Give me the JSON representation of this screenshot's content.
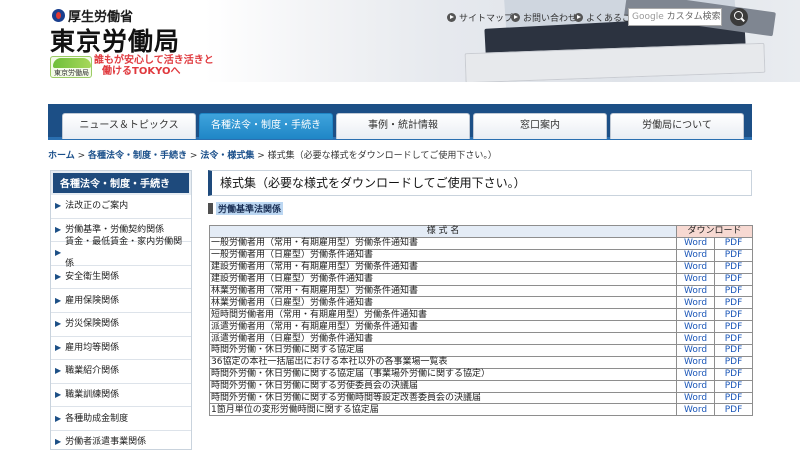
{
  "header": {
    "ministry": "厚生労働省",
    "bureau": "東京労働局",
    "badge_text": "東京労働局",
    "slogan_line1": "誰もが安心して活き活きと",
    "slogan_line2": "働けるTOKYOへ",
    "utility_links": [
      "サイトマップ",
      "お問い合わせ",
      "よくあるご質問"
    ],
    "search_logo": "Google",
    "search_placeholder": "カスタム検索"
  },
  "nav": {
    "tabs": [
      "ニュース＆トピックス",
      "各種法令・制度・手続き",
      "事例・統計情報",
      "窓口案内",
      "労働局について"
    ],
    "active_index": 1
  },
  "breadcrumb": {
    "items": [
      "ホーム",
      "各種法令・制度・手続き",
      "法令・様式集"
    ],
    "current": "様式集（必要な様式をダウンロードしてご使用下さい。）",
    "separator": ">"
  },
  "sidebar": {
    "heading": "各種法令・制度・手続き",
    "items": [
      "法改正のご案内",
      "労働基準・労働契約関係",
      "賃金・最低賃金・家内労働関係",
      "安全衛生関係",
      "雇用保険関係",
      "労災保険関係",
      "雇用均等関係",
      "職業紹介関係",
      "職業訓練関係",
      "各種助成金制度",
      "労働者派遣事業関係"
    ]
  },
  "main": {
    "page_title": "様式集（必要な様式をダウンロードしてご使用下さい。）",
    "section": "労働基準法関係",
    "table_header_name": "様 式 名",
    "table_header_download": "ダウンロード",
    "word_label": "Word",
    "pdf_label": "PDF",
    "rows": [
      "一般労働者用（常用・有期雇用型）労働条件通知書",
      "一般労働者用（日雇型）労働条件通知書",
      "建設労働者用（常用・有期雇用型）労働条件通知書",
      "建設労働者用（日雇型）労働条件通知書",
      "林業労働者用（常用・有期雇用型）労働条件通知書",
      "林業労働者用（日雇型）労働条件通知書",
      "短時間労働者用（常用・有期雇用型）労働条件通知書",
      "派遣労働者用（常用・有期雇用型）労働条件通知書",
      "派遣労働者用（日雇型）労働条件通知書",
      "時間外労働・休日労働に関する協定届",
      "36協定の本社一括届出における本社以外の各事業場一覧表",
      "時間外労働・休日労働に関する協定届（事業場外労働に関する協定）",
      "時間外労働・休日労働に関する労使委員会の決議届",
      "時間外労働・休日労働に関する労働時間等設定改善委員会の決議届",
      "1箇月単位の変形労働時間に関する協定届"
    ]
  }
}
